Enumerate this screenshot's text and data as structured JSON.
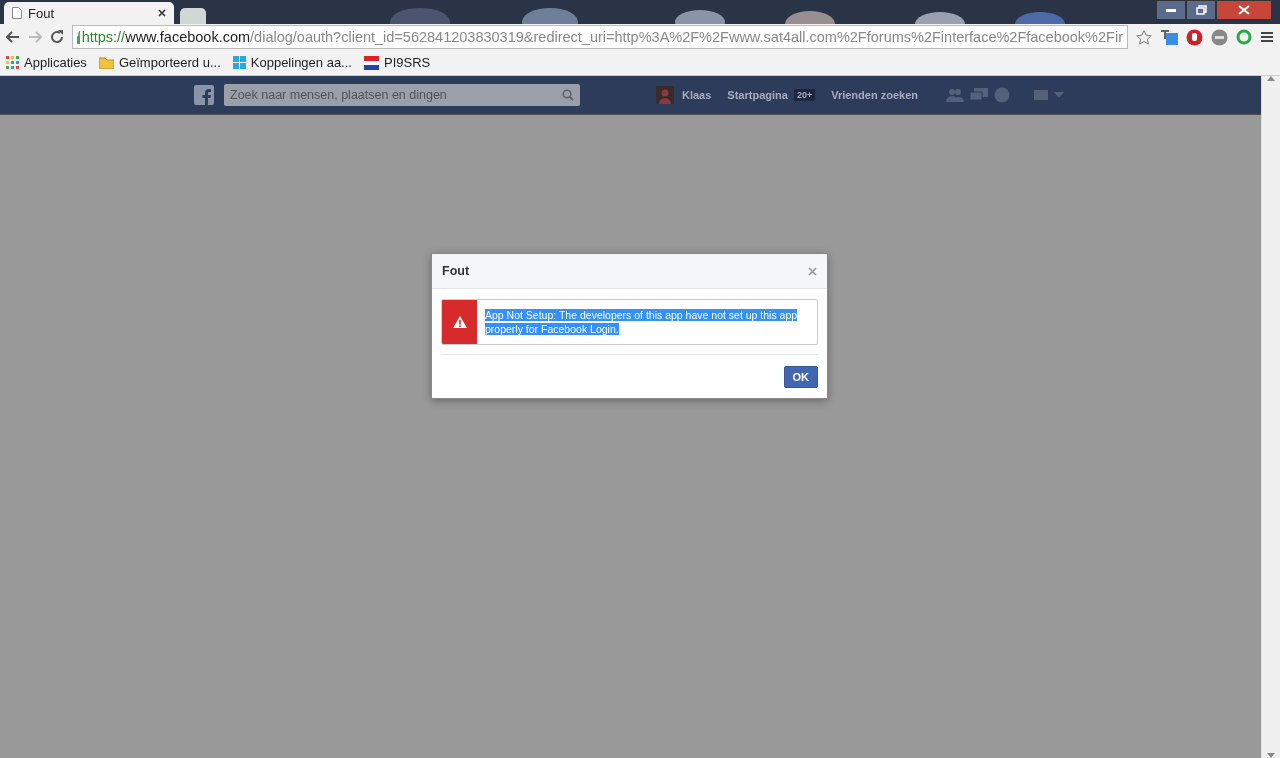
{
  "browser": {
    "tabs": [
      {
        "title": "Fout",
        "selected": true
      },
      {
        "selected": false
      }
    ],
    "address": {
      "scheme": "https://",
      "host": "www.facebook.com",
      "path": "/dialog/oauth?client_id=562841203830319&redirect_uri=http%3A%2F%2Fwww.sat4all.com%2Fforums%2Finterface%2Ffacebook%2Fir"
    },
    "bookmarks": [
      {
        "kind": "apps",
        "label": "Applicaties"
      },
      {
        "kind": "folder",
        "label": "Geïmporteerd u..."
      },
      {
        "kind": "windows",
        "label": "Koppelingen aa..."
      },
      {
        "kind": "flag",
        "label": "PI9SRS"
      }
    ]
  },
  "facebook": {
    "search": {
      "placeholder": "Zoek naar mensen, plaatsen en dingen"
    },
    "user": "Klaas",
    "home": "Startpagina",
    "home_badge": "20+",
    "find_friends": "Vrienden zoeken"
  },
  "dialog": {
    "title": "Fout",
    "message": "App Not Setup: The developers of this app have not set up this app properly for Facebook Login.",
    "message_highlighted": true,
    "button": "OK"
  }
}
